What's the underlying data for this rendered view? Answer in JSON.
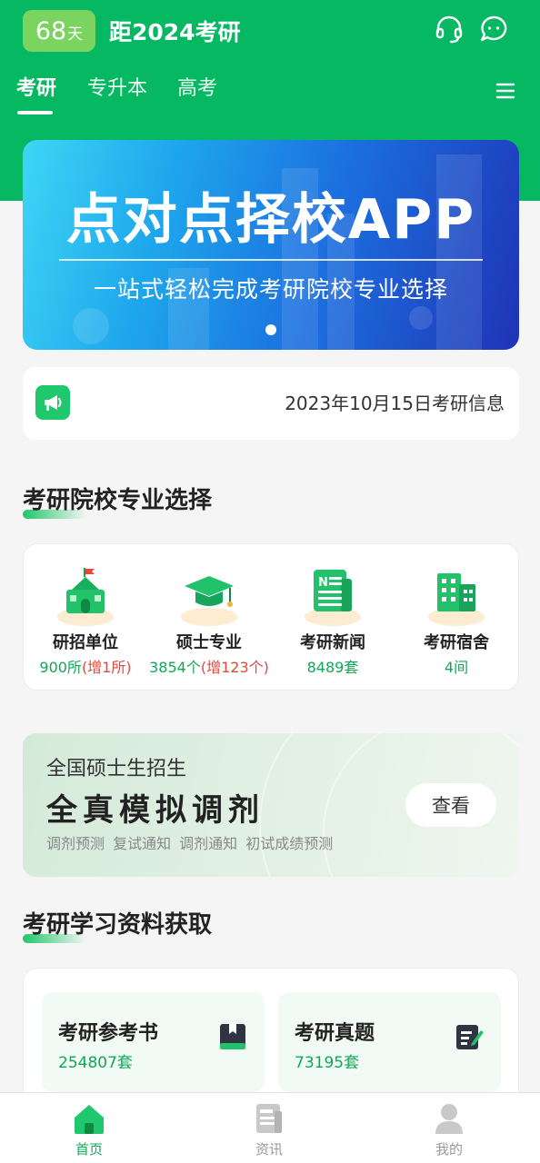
{
  "header": {
    "countdown_number": "68",
    "countdown_unit": "天",
    "title": "距2024考研"
  },
  "tabs": [
    {
      "label": "考研",
      "active": true
    },
    {
      "label": "专升本",
      "active": false
    },
    {
      "label": "高考",
      "active": false
    }
  ],
  "banner": {
    "title": "点对点择校APP",
    "subtitle": "一站式轻松完成考研院校专业选择",
    "slide_count": 1
  },
  "notice": {
    "text": "2023年10月15日考研信息"
  },
  "school_section": {
    "title": "考研院校专业选择",
    "features": [
      {
        "name": "研招单位",
        "value": "900所",
        "extra": "(增1所)",
        "icon": "school-icon"
      },
      {
        "name": "硕士专业",
        "value": "3854个",
        "extra": "(增123个)",
        "icon": "graduation-cap-icon"
      },
      {
        "name": "考研新闻",
        "value": "8489套",
        "extra": "",
        "icon": "newspaper-icon"
      },
      {
        "name": "考研宿舍",
        "value": "4间",
        "extra": "",
        "icon": "dormitory-icon"
      }
    ]
  },
  "mock_banner": {
    "subtitle": "全国硕士生招生",
    "title": "全真模拟调剂",
    "tags": "调剂预测 复试通知 调剂通知 初试成绩预测",
    "button": "查看"
  },
  "material_section": {
    "title": "考研学习资料获取",
    "items": [
      {
        "name": "考研参考书",
        "value": "254807套",
        "icon": "book-icon"
      },
      {
        "name": "考研真题",
        "value": "73195套",
        "icon": "edit-paper-icon"
      }
    ]
  },
  "bottom_nav": [
    {
      "label": "首页",
      "icon": "home-icon",
      "active": true
    },
    {
      "label": "资讯",
      "icon": "news-icon",
      "active": false
    },
    {
      "label": "我的",
      "icon": "user-icon",
      "active": false
    }
  ],
  "colors": {
    "brand_green": "#07b863",
    "countdown_bg": "#7bd45f",
    "value_green": "#10a857",
    "increase_red": "#e04a3b"
  }
}
